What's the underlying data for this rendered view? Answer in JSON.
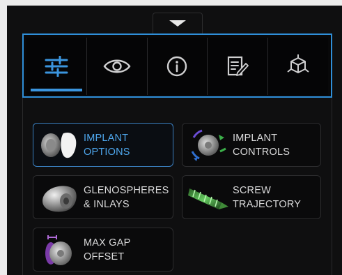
{
  "toolbar": {
    "tabs": [
      {
        "icon": "sliders-icon",
        "active": true
      },
      {
        "icon": "eye-icon",
        "active": false
      },
      {
        "icon": "info-icon",
        "active": false
      },
      {
        "icon": "notes-edit-icon",
        "active": false
      },
      {
        "icon": "3d-cube-icon",
        "active": false
      }
    ],
    "accent_color": "#2f8fd9"
  },
  "tiles": {
    "implant_options": {
      "label": "IMPLANT\nOPTIONS",
      "selected": true
    },
    "implant_controls": {
      "label": "IMPLANT\nCONTROLS",
      "selected": false
    },
    "glenospheres": {
      "label": "GLENOSPHERES\n& INLAYS",
      "selected": false
    },
    "screw_trajectory": {
      "label": "SCREW\nTRAJECTORY",
      "selected": false
    },
    "max_gap_offset": {
      "label": "MAX GAP\nOFFSET",
      "selected": false
    }
  }
}
